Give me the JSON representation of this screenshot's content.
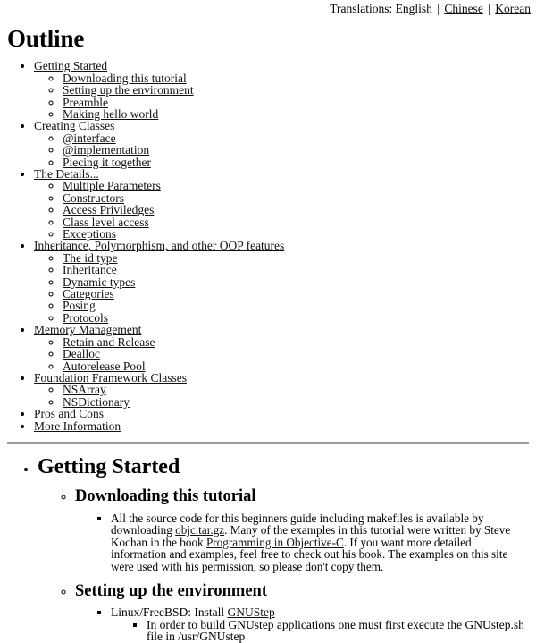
{
  "translations": {
    "label": "Translations:",
    "current": "English",
    "separator": "|",
    "links": [
      {
        "label": "Chinese"
      },
      {
        "label": "Korean"
      }
    ]
  },
  "outline": {
    "title": "Outline",
    "sections": [
      {
        "label": "Getting Started",
        "children": [
          {
            "label": "Downloading this tutorial"
          },
          {
            "label": "Setting up the environment"
          },
          {
            "label": "Preamble"
          },
          {
            "label": "Making hello world"
          }
        ]
      },
      {
        "label": "Creating Classes",
        "children": [
          {
            "label": "@interface"
          },
          {
            "label": "@implementation"
          },
          {
            "label": "Piecing it together"
          }
        ]
      },
      {
        "label": "The Details...",
        "children": [
          {
            "label": "Multiple Parameters"
          },
          {
            "label": "Constructors"
          },
          {
            "label": "Access Priviledges"
          },
          {
            "label": "Class level access"
          },
          {
            "label": "Exceptions"
          }
        ]
      },
      {
        "label": "Inheritance, Polymorphism, and other OOP features",
        "children": [
          {
            "label": "The id type"
          },
          {
            "label": "Inheritance"
          },
          {
            "label": "Dynamic types"
          },
          {
            "label": "Categories"
          },
          {
            "label": "Posing"
          },
          {
            "label": "Protocols"
          }
        ]
      },
      {
        "label": "Memory Management",
        "children": [
          {
            "label": "Retain and Release"
          },
          {
            "label": "Dealloc"
          },
          {
            "label": "Autorelease Pool"
          }
        ]
      },
      {
        "label": "Foundation Framework Classes",
        "children": [
          {
            "label": "NSArray"
          },
          {
            "label": "NSDictionary"
          }
        ]
      },
      {
        "label": "Pros and Cons",
        "children": []
      },
      {
        "label": "More Information",
        "children": []
      }
    ]
  },
  "content": {
    "section_heading": "Getting Started",
    "sub1": {
      "heading": "Downloading this tutorial",
      "paragraph": {
        "part1": "All the source code for this beginners guide including makefiles is available by downloading ",
        "link1": "objc.tar.gz",
        "part2": ". Many of the examples in this tutorial were written by Steve Kochan in the book ",
        "link2": "Programming in Objective-C",
        "part3": ". If you want more detailed information and examples, feel free to check out his book. The examples on this site were used with his permission, so please don't copy them."
      }
    },
    "sub2": {
      "heading": "Setting up the environment",
      "item_prefix": "Linux/FreeBSD: Install ",
      "item_link": "GNUStep",
      "subitem": "In order to build GNUstep applications one must first execute the GNUstep.sh file in /usr/GNUstep"
    }
  }
}
